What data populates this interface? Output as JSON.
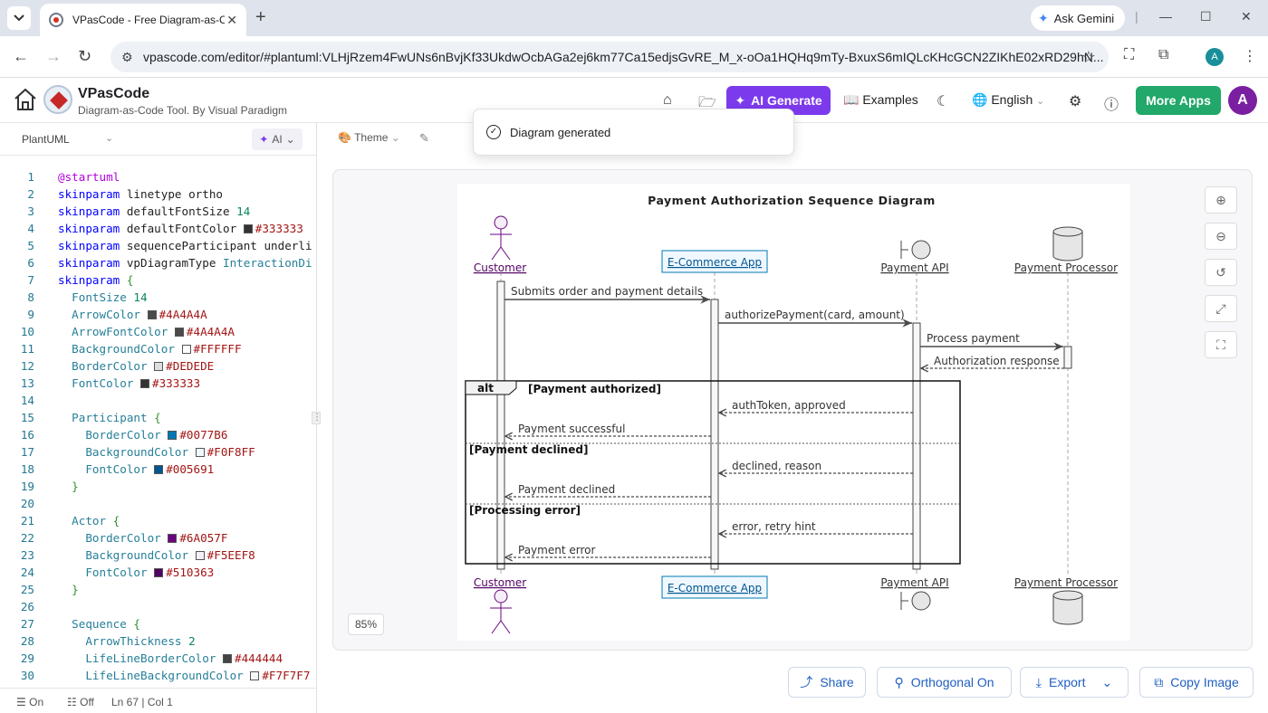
{
  "browser": {
    "tab_title": "VPasCode - Free Diagram-as-Co",
    "url": "vpascode.com/editor/#plantuml:VLHjRzem4FwUNs6nBvjKf33UkdwOcbAGa2ej6km77Ca15edjsGvRE_M_x-oOa1HQHq9mTy-BxuxS6mIQLcKHcGCN2ZIKhE02xRD29hN...",
    "gemini_label": "Ask Gemini",
    "profile_letter": "A"
  },
  "app": {
    "brand": "VPasCode",
    "tagline": "Diagram-as-Code Tool. By Visual Paradigm",
    "ai_generate": "AI Generate",
    "examples": "Examples",
    "language": "English",
    "more_apps": "More Apps",
    "avatar_letter": "A",
    "accent_purple": "#7c3aed",
    "accent_green": "#21a86a"
  },
  "editor": {
    "language": "PlantUML",
    "ai_label": "AI",
    "status_wrap": "On",
    "status_minimap": "Off",
    "status_position": "Ln 67 | Col 1",
    "lines": [
      {
        "n": "1"
      },
      {
        "n": "2"
      },
      {
        "n": "3"
      },
      {
        "n": "4"
      },
      {
        "n": "5"
      },
      {
        "n": "6"
      },
      {
        "n": "7"
      },
      {
        "n": "8"
      },
      {
        "n": "9"
      },
      {
        "n": "10"
      },
      {
        "n": "11"
      },
      {
        "n": "12"
      },
      {
        "n": "13"
      },
      {
        "n": "14"
      },
      {
        "n": "15"
      },
      {
        "n": "16"
      },
      {
        "n": "17"
      },
      {
        "n": "18"
      },
      {
        "n": "19"
      },
      {
        "n": "20"
      },
      {
        "n": "21"
      },
      {
        "n": "22"
      },
      {
        "n": "23"
      },
      {
        "n": "24"
      },
      {
        "n": "25"
      },
      {
        "n": "26"
      },
      {
        "n": "27"
      },
      {
        "n": "28"
      },
      {
        "n": "29"
      },
      {
        "n": "30"
      }
    ],
    "code": {
      "l1": "@startuml",
      "l2a": "skinparam",
      "l2b": " linetype ortho",
      "l3a": "skinparam",
      "l3b": " defaultFontSize ",
      "l3c": "14",
      "l4a": "skinparam",
      "l4b": " defaultFontColor ",
      "l4c": "#333333",
      "l5a": "skinparam",
      "l5b": " sequenceParticipant underli",
      "l6a": "skinparam",
      "l6b": " vpDiagramType ",
      "l6c": "InteractionDi",
      "l7a": "skinparam",
      "l7b": " {",
      "l8a": "FontSize",
      "l8b": " 14",
      "l9a": "ArrowColor",
      "l9b": "#4A4A4A",
      "l10a": "ArrowFontColor",
      "l10b": "#4A4A4A",
      "l11a": "BackgroundColor",
      "l11b": "#FFFFFF",
      "l12a": "BorderColor",
      "l12b": "#DEDEDE",
      "l13a": "FontColor",
      "l13b": "#333333",
      "l15a": "Participant",
      "l15b": " {",
      "l16a": "BorderColor",
      "l16b": "#0077B6",
      "l17a": "BackgroundColor",
      "l17b": "#F0F8FF",
      "l18a": "FontColor",
      "l18b": "#005691",
      "l19": "}",
      "l21a": "Actor",
      "l21b": " {",
      "l22a": "BorderColor",
      "l22b": "#6A057F",
      "l23a": "BackgroundColor",
      "l23b": "#F5EEF8",
      "l24a": "FontColor",
      "l24b": "#510363",
      "l25": "}",
      "l27a": "Sequence",
      "l27b": " {",
      "l28a": "ArrowThickness",
      "l28b": " 2",
      "l29a": "LifeLineBorderColor",
      "l29b": "#444444",
      "l30a": "LifeLineBackgroundColor",
      "l30b": "#F7F7F7"
    }
  },
  "diagram_toolbar": {
    "theme": "Theme",
    "zoom": "85%"
  },
  "toast": {
    "message": "Diagram generated"
  },
  "diagram": {
    "title": "Payment Authorization Sequence Diagram",
    "participants": {
      "customer": "Customer",
      "app": "E-Commerce App",
      "api": "Payment API",
      "processor": "Payment Processor"
    },
    "messages": {
      "m1": "Submits order and payment details",
      "m2": "authorizePayment(card, amount)",
      "m3": "Process payment",
      "m4": "Authorization response",
      "m5": "authToken, approved",
      "m6": "Payment successful",
      "m7": "declined, reason",
      "m8": "Payment declined",
      "m9": "error, retry hint",
      "m10": "Payment error"
    },
    "fragment": {
      "label": "alt",
      "guard1": "[Payment authorized]",
      "guard2": "[Payment declined]",
      "guard3": "[Processing error]"
    }
  },
  "bottom_actions": {
    "share": "Share",
    "orthogonal": "Orthogonal On",
    "export": "Export",
    "copy_image": "Copy Image"
  }
}
